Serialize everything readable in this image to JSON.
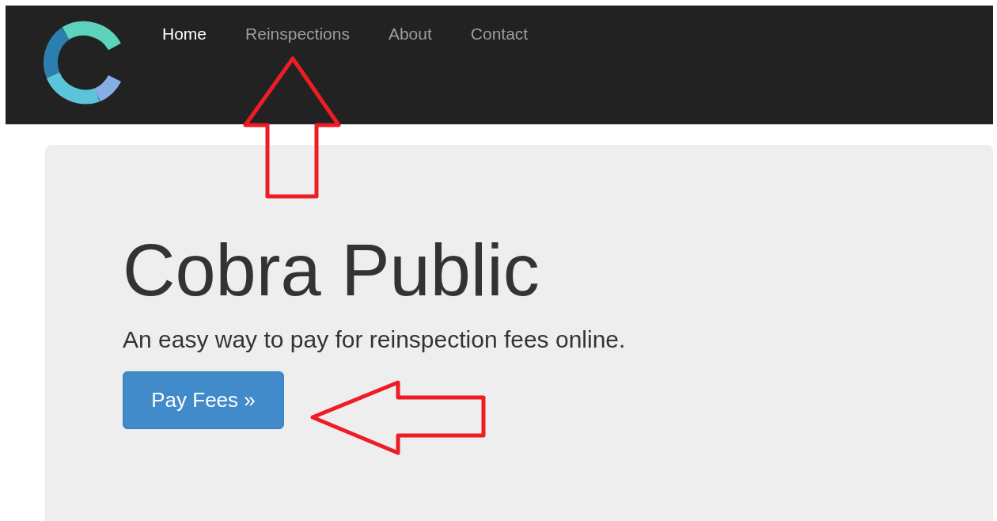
{
  "navbar": {
    "items": [
      {
        "label": "Home",
        "selected": true
      },
      {
        "label": "Reinspections",
        "selected": false
      },
      {
        "label": "About",
        "selected": false
      },
      {
        "label": "Contact",
        "selected": false
      }
    ]
  },
  "hero": {
    "title": "Cobra Public",
    "subtitle": "An easy way to pay for reinspection fees online.",
    "button": "Pay Fees »"
  }
}
